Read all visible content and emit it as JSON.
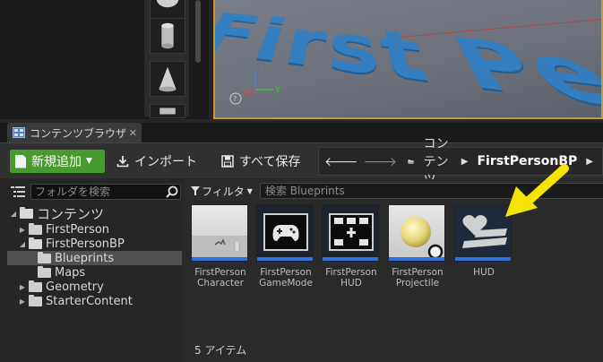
{
  "tab": {
    "title": "コンテンツブラウザ"
  },
  "toolbar": {
    "add_new": "新規追加",
    "import": "インポート",
    "save_all": "すべて保存"
  },
  "path": [
    "コンテンツ",
    "FirstPersonBP"
  ],
  "tree": {
    "search_placeholder": "フォルダを検索",
    "root": "コンテンツ",
    "items": [
      {
        "label": "FirstPerson"
      },
      {
        "label": "FirstPersonBP"
      },
      {
        "label": "Blueprints"
      },
      {
        "label": "Maps"
      },
      {
        "label": "Geometry"
      },
      {
        "label": "StarterContent"
      }
    ]
  },
  "assets": {
    "filter_label": "フィルタ",
    "search_placeholder": "検索 Blueprints",
    "items": [
      {
        "label": "FirstPerson\nCharacter",
        "icon": "character-thumb"
      },
      {
        "label": "FirstPerson\nGameMode",
        "icon": "gamepad-icon"
      },
      {
        "label": "FirstPerson\nHUD",
        "icon": "hud-add-icon"
      },
      {
        "label": "FirstPerson\nProjectile",
        "icon": "sphere-thumb"
      },
      {
        "label": "HUD",
        "icon": "heart-hud-icon"
      }
    ],
    "count_label": "5 アイテム"
  },
  "viewport": {
    "text": "First Pers"
  },
  "colors": {
    "accent_green": "#479b2e",
    "asset_bar": "#2f6fd6",
    "annotation": "#f4e400",
    "viewport_border": "#c99a2e"
  }
}
